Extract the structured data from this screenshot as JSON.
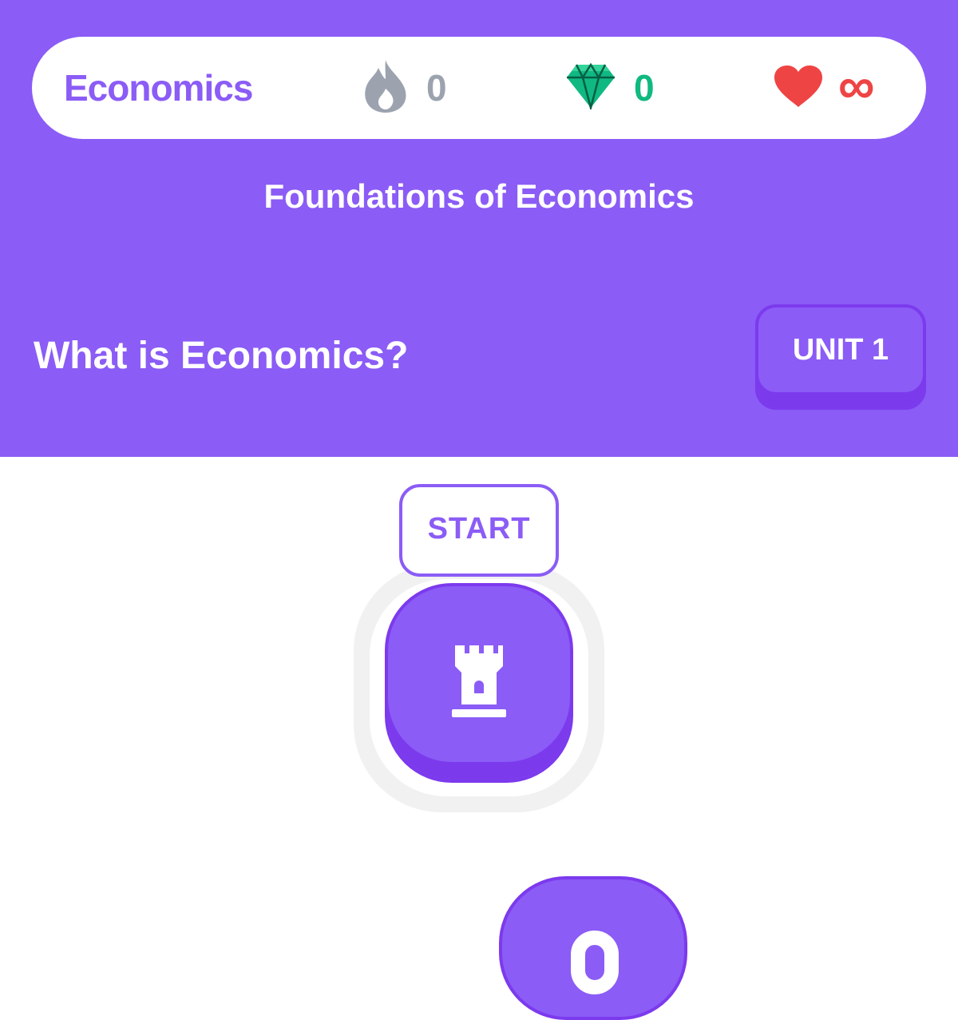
{
  "status": {
    "course_name": "Economics",
    "streak": {
      "icon": "flame-icon",
      "value": "0",
      "color": "#9ca3af"
    },
    "gems": {
      "icon": "gem-icon",
      "value": "0",
      "color": "#10b981"
    },
    "hearts": {
      "icon": "heart-icon",
      "value": "∞",
      "color": "#ef4444"
    }
  },
  "course_title": "Foundations of Economics",
  "unit": {
    "title": "What is Economics?",
    "badge_label": "UNIT 1"
  },
  "path": {
    "start_label": "START",
    "current_node_icon": "castle-icon",
    "next_node_icon": "lock-icon"
  },
  "colors": {
    "primary": "#8b5cf6",
    "primary_dark": "#7c3aed",
    "background": "#ffffff"
  }
}
